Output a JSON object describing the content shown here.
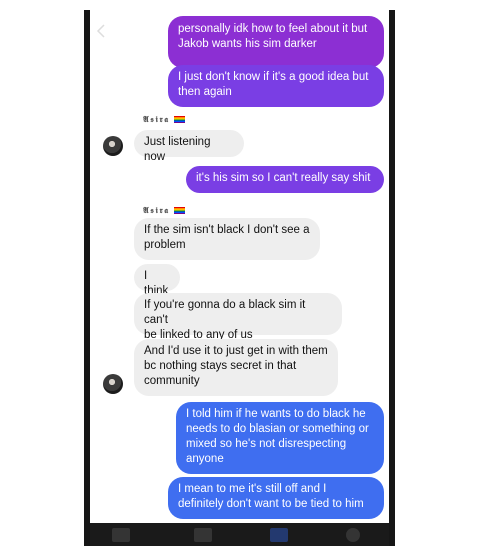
{
  "icons": {
    "back": "chevron-left-icon",
    "avatar": "user-avatar-icon",
    "flag": "rainbow-flag-icon"
  },
  "colors": {
    "outgoing_purple": "#8c2fd3",
    "outgoing_violet": "#7a3ee4",
    "outgoing_blue": "#3f6ef0",
    "incoming_gray": "#eeeeee"
  },
  "sender": {
    "name": "𝕬𝖘𝖎𝖗𝖆"
  },
  "messages": [
    {
      "dir": "out",
      "text": "personally idk how to feel about it but\nJakob wants his sim darker"
    },
    {
      "dir": "out",
      "text": "I just don't know if it's a good idea but\nthen again"
    },
    {
      "dir": "in",
      "text": "Just listening now"
    },
    {
      "dir": "out",
      "text": "it's his sim so I can't really say shit"
    },
    {
      "dir": "in",
      "text": "If the sim isn't black I don't see a\nproblem"
    },
    {
      "dir": "in",
      "text": "I think"
    },
    {
      "dir": "in",
      "text": "If you're gonna do a black sim it can't\nbe linked to any of us"
    },
    {
      "dir": "in",
      "text": "And I'd use it to just get in with them\nbc nothing stays secret in that\ncommunity"
    },
    {
      "dir": "out",
      "text": "I told him if he wants to do black he\nneeds to do blasian or something or\nmixed so he's not disrespecting\nanyone"
    },
    {
      "dir": "out",
      "text": "I mean to me it's still off and I\ndefinitely don't want to be tied to him"
    }
  ]
}
